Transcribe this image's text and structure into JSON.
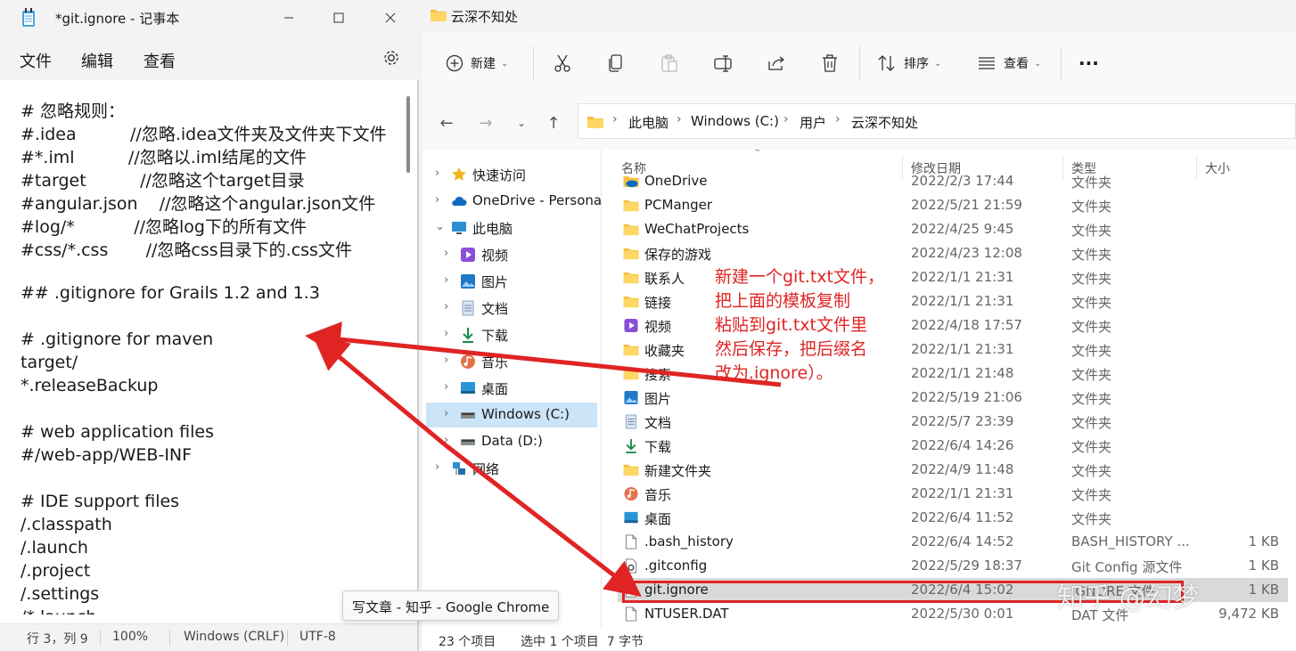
{
  "notepad": {
    "title": "*git.ignore - 记事本",
    "menu": [
      "文件",
      "编辑",
      "查看"
    ],
    "lines": [
      "# 忽略规则：",
      "#.idea          //忽略.idea文件夹及文件夹下文件",
      "#*.iml          //忽略以.iml结尾的文件",
      "#target          //忽略这个target目录",
      "#angular.json    //忽略这个angular.json文件",
      "#log/*           //忽略log下的所有文件",
      "#css/*.css       //忽略css目录下的.css文件",
      "",
      "## .gitignore for Grails 1.2 and 1.3",
      "",
      "# .gitignore for maven",
      "target/",
      "*.releaseBackup",
      "",
      "# web application files",
      "#/web-app/WEB-INF",
      "",
      "# IDE support files",
      "/.classpath",
      "/.launch",
      "/.project",
      "/.settings",
      "/*.launch"
    ],
    "status": {
      "position": "行 3，列 9",
      "zoom": "100%",
      "line_ending": "Windows (CRLF)",
      "encoding": "UTF-8"
    }
  },
  "explorer": {
    "title": "云深不知处",
    "toolbar": {
      "new_label": "新建",
      "sort_label": "排序",
      "view_label": "查看",
      "more_label": "···"
    },
    "breadcrumbs": [
      "此电脑",
      "Windows (C:)",
      "用户",
      "云深不知处"
    ],
    "sidebar": [
      {
        "label": "快速访问",
        "icon": "star-icon",
        "level": 0,
        "expand": "›"
      },
      {
        "label": "OneDrive - Personal",
        "icon": "cloud-icon",
        "level": 0,
        "expand": "›"
      },
      {
        "label": "此电脑",
        "icon": "computer-icon",
        "level": 0,
        "expand": "⌄"
      },
      {
        "label": "视频",
        "icon": "video-icon",
        "level": 1,
        "expand": "›"
      },
      {
        "label": "图片",
        "icon": "picture-icon",
        "level": 1,
        "expand": "›"
      },
      {
        "label": "文档",
        "icon": "document-icon",
        "level": 1,
        "expand": "›"
      },
      {
        "label": "下载",
        "icon": "download-icon",
        "level": 1,
        "expand": "›"
      },
      {
        "label": "音乐",
        "icon": "music-icon",
        "level": 1,
        "expand": "›"
      },
      {
        "label": "桌面",
        "icon": "desktop-icon",
        "level": 1,
        "expand": "›"
      },
      {
        "label": "Windows (C:)",
        "icon": "drive-icon",
        "level": 1,
        "expand": "›",
        "selected": true
      },
      {
        "label": "Data (D:)",
        "icon": "drive-icon",
        "level": 1,
        "expand": "›"
      },
      {
        "label": "网络",
        "icon": "network-icon",
        "level": 0,
        "expand": "›"
      }
    ],
    "columns": {
      "name": "名称",
      "date": "修改日期",
      "type": "类型",
      "size": "大小"
    },
    "files": [
      {
        "name": "OneDrive",
        "date": "2022/2/3 17:44",
        "type": "文件夹",
        "size": "",
        "icon": "onedrive-folder-icon"
      },
      {
        "name": "PCManger",
        "date": "2022/5/21 21:59",
        "type": "文件夹",
        "size": "",
        "icon": "folder-icon"
      },
      {
        "name": "WeChatProjects",
        "date": "2022/4/25 9:45",
        "type": "文件夹",
        "size": "",
        "icon": "folder-icon"
      },
      {
        "name": "保存的游戏",
        "date": "2022/4/23 12:08",
        "type": "文件夹",
        "size": "",
        "icon": "folder-icon"
      },
      {
        "name": "联系人",
        "date": "2022/1/1 21:31",
        "type": "文件夹",
        "size": "",
        "icon": "folder-icon"
      },
      {
        "name": "链接",
        "date": "2022/1/1 21:31",
        "type": "文件夹",
        "size": "",
        "icon": "folder-icon"
      },
      {
        "name": "视频",
        "date": "2022/4/18 17:57",
        "type": "文件夹",
        "size": "",
        "icon": "video-icon"
      },
      {
        "name": "收藏夹",
        "date": "2022/1/1 21:31",
        "type": "文件夹",
        "size": "",
        "icon": "folder-icon"
      },
      {
        "name": "搜索",
        "date": "2022/1/1 21:48",
        "type": "文件夹",
        "size": "",
        "icon": "folder-icon"
      },
      {
        "name": "图片",
        "date": "2022/5/19 21:06",
        "type": "文件夹",
        "size": "",
        "icon": "picture-icon"
      },
      {
        "name": "文档",
        "date": "2022/5/7 23:39",
        "type": "文件夹",
        "size": "",
        "icon": "document-icon"
      },
      {
        "name": "下载",
        "date": "2022/6/4 14:26",
        "type": "文件夹",
        "size": "",
        "icon": "download-icon"
      },
      {
        "name": "新建文件夹",
        "date": "2022/4/9 11:48",
        "type": "文件夹",
        "size": "",
        "icon": "folder-icon"
      },
      {
        "name": "音乐",
        "date": "2022/1/1 21:31",
        "type": "文件夹",
        "size": "",
        "icon": "music-icon"
      },
      {
        "name": "桌面",
        "date": "2022/6/4 11:52",
        "type": "文件夹",
        "size": "",
        "icon": "desktop-icon"
      },
      {
        "name": ".bash_history",
        "date": "2022/6/4 14:52",
        "type": "BASH_HISTORY ...",
        "size": "1 KB",
        "icon": "file-icon"
      },
      {
        "name": ".gitconfig",
        "date": "2022/5/29 18:37",
        "type": "Git Config 源文件",
        "size": "1 KB",
        "icon": "config-file-icon"
      },
      {
        "name": "git.ignore",
        "date": "2022/6/4 15:02",
        "type": "IGNORE 文件",
        "size": "1 KB",
        "icon": "file-icon",
        "selected": true
      },
      {
        "name": "NTUSER.DAT",
        "date": "2022/5/30 0:01",
        "type": "DAT 文件",
        "size": "9,472 KB",
        "icon": "file-icon"
      }
    ],
    "status": {
      "count": "23 个项目",
      "selection": "选中 1 个项目  7 字节"
    }
  },
  "tooltip": "写文章 - 知乎 - Google Chrome",
  "annotation": [
    "新建一个git.txt文件，",
    "把上面的模板复制",
    "粘贴到git.txt文件里",
    "然后保存，把后缀名",
    "改为.ignore）。"
  ],
  "watermark": "知乎 @幻梦",
  "colors": {
    "annotation": "#e02424",
    "selection": "#cce4f7",
    "folder": "#f5c242",
    "accent": "#0067c0"
  }
}
